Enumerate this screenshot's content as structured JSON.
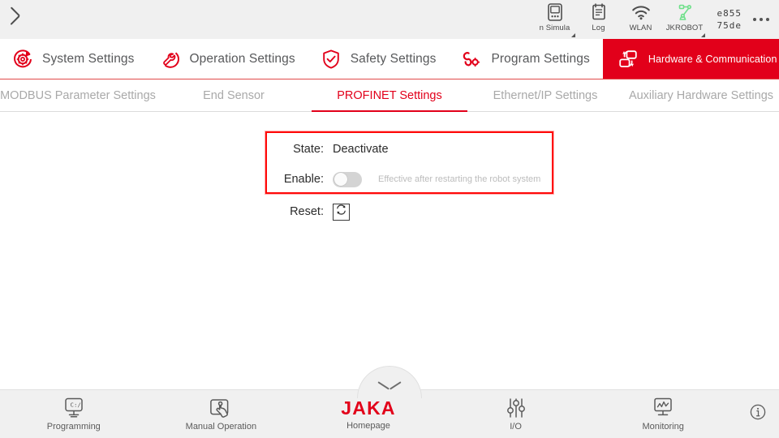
{
  "statusbar": {
    "back_icon": "chevron-left-icon",
    "items": [
      {
        "label": "n Simula",
        "icon": "simulation-monitor-icon",
        "has_corner_marker": true
      },
      {
        "label": "Log",
        "icon": "log-document-icon",
        "has_corner_marker": false
      },
      {
        "label": "WLAN",
        "icon": "wifi-icon",
        "has_corner_marker": false
      },
      {
        "label": "JKROBOT",
        "icon": "robot-arm-icon",
        "has_corner_marker": true
      }
    ],
    "device_id_line1": "e855",
    "device_id_line2": "75de",
    "overflow_icon": "kebab-menu-icon"
  },
  "mainnav": {
    "tabs": [
      {
        "label": "System Settings",
        "icon": "gear-refresh-icon",
        "active": false
      },
      {
        "label": "Operation Settings",
        "icon": "wrench-circle-icon",
        "active": false
      },
      {
        "label": "Safety Settings",
        "icon": "shield-check-icon",
        "active": false
      },
      {
        "label": "Program Settings",
        "icon": "program-node-icon",
        "active": false
      },
      {
        "label": "Hardware & Communication",
        "icon": "hardware-blocks-icon",
        "active": true
      }
    ]
  },
  "subnav": {
    "tabs": [
      {
        "label": "MODBUS Parameter Settings",
        "active": false
      },
      {
        "label": "End Sensor",
        "active": false
      },
      {
        "label": "PROFINET Settings",
        "active": true
      },
      {
        "label": "Ethernet/IP Settings",
        "active": false
      },
      {
        "label": "Auxiliary Hardware Settings",
        "active": false
      }
    ]
  },
  "content": {
    "state_label": "State:",
    "state_value": "Deactivate",
    "enable_label": "Enable:",
    "enable_toggle_on": false,
    "enable_hint": "Effective after restarting the robot system",
    "reset_label": "Reset:",
    "reset_icon": "refresh-sync-icon",
    "highlight_color": "#ff0909"
  },
  "bottombar": {
    "pull_handle_icon": "chevron-down-icon",
    "items": [
      {
        "label": "Programming",
        "icon": "monitor-code-icon",
        "brand": false
      },
      {
        "label": "Manual Operation",
        "icon": "hand-touch-icon",
        "brand": false
      },
      {
        "label": "Homepage",
        "icon": "jaka-logo",
        "brand": true,
        "brand_text": "JAKA"
      },
      {
        "label": "I/O",
        "icon": "sliders-icon",
        "brand": false
      },
      {
        "label": "Monitoring",
        "icon": "monitor-chart-icon",
        "brand": false
      }
    ],
    "info_icon": "info-circle-icon"
  },
  "colors": {
    "brand_red": "#e2001a",
    "status_bg": "#f0f0f0",
    "text_dark": "#2b2b2b",
    "text_muted": "#a9a9a9"
  }
}
